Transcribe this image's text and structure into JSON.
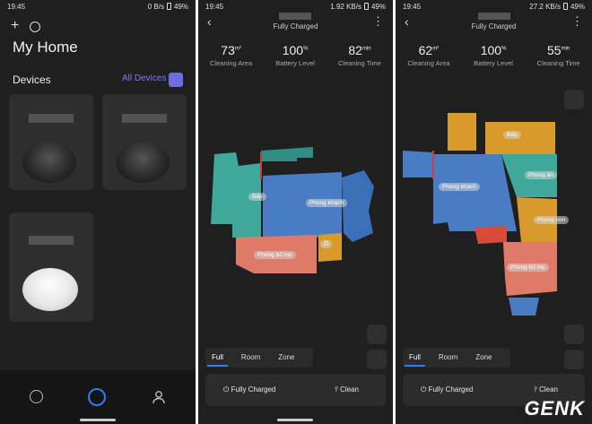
{
  "phone1": {
    "status": {
      "time": "19:45",
      "speed": "0 B/s",
      "battery": "49%"
    },
    "title": "My Home",
    "devices_label": "Devices",
    "all_devices": "All Devices"
  },
  "phone2": {
    "status": {
      "time": "19:45",
      "speed": "1.92 KB/s",
      "battery": "49%"
    },
    "subtitle": "Fully Charged",
    "stats": [
      {
        "value": "73",
        "unit": "m²",
        "label": "Cleaning Area"
      },
      {
        "value": "100",
        "unit": "%",
        "label": "Battery Level"
      },
      {
        "value": "82",
        "unit": "min",
        "label": "Cleaning Time"
      }
    ],
    "rooms": [
      "Bếp",
      "Phòng khách",
      "Phòng bố mẹ",
      "Ô"
    ],
    "tabs": [
      "Full",
      "Room",
      "Zone"
    ],
    "bottom": {
      "status": "Fully Charged",
      "action": "Clean"
    }
  },
  "phone3": {
    "status": {
      "time": "19:45",
      "speed": "27.2 KB/s",
      "battery": "49%"
    },
    "subtitle": "Fully Charged",
    "stats": [
      {
        "value": "62",
        "unit": "m²",
        "label": "Cleaning Area"
      },
      {
        "value": "100",
        "unit": "%",
        "label": "Battery Level"
      },
      {
        "value": "55",
        "unit": "min",
        "label": "Cleaning Time"
      }
    ],
    "rooms": [
      "Bếp",
      "Phòng ăn",
      "Phòng khách",
      "Phòng con",
      "Phòng bố mẹ"
    ],
    "tabs": [
      "Full",
      "Room",
      "Zone"
    ],
    "bottom": {
      "status": "Fully Charged",
      "action": "Clean"
    }
  },
  "watermark": "GENK",
  "colors": {
    "accent": "#6f6ce0",
    "tab_active": "#2f7bf6",
    "room_blue": "#4a7cc4",
    "room_teal": "#3fa89a",
    "room_salmon": "#e07a68",
    "room_orange": "#d99a2c",
    "wall_red": "#d43a3a"
  }
}
